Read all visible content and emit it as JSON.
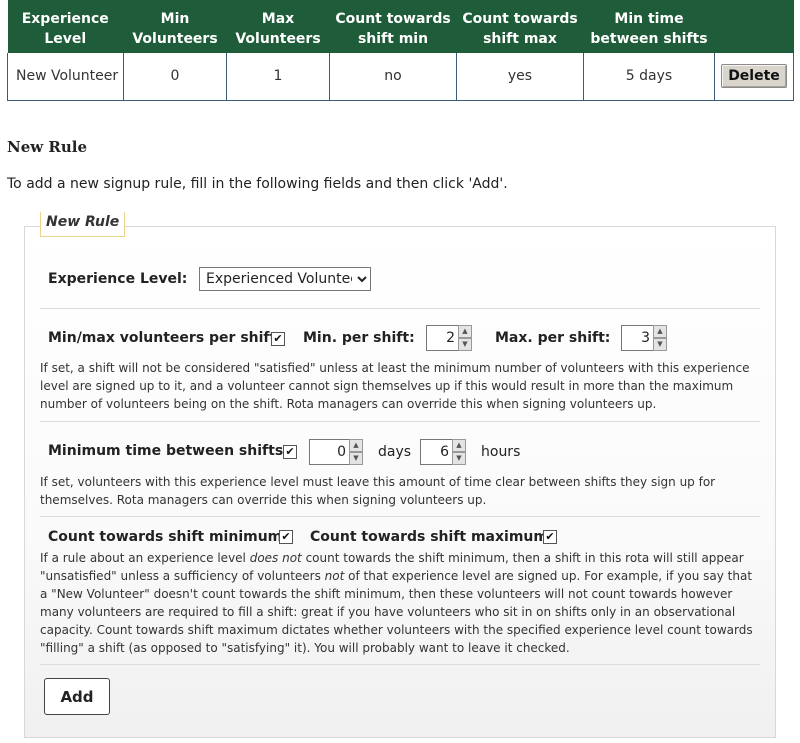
{
  "table": {
    "headers": [
      "Experience Level",
      "Min Volunteers",
      "Max Volunteers",
      "Count towards shift min",
      "Count towards shift max",
      "Min time between shifts"
    ],
    "rows": [
      {
        "level": "New Volunteer",
        "min": "0",
        "max": "1",
        "count_min": "no",
        "count_max": "yes",
        "min_time": "5 days",
        "delete_label": "Delete"
      }
    ]
  },
  "new_rule": {
    "heading": "New Rule",
    "intro": "To add a new signup rule, fill in the following fields and then click 'Add'.",
    "legend": "New Rule",
    "experience_label": "Experience Level:",
    "experience_selected": "Experienced Volunteer",
    "minmax_label": "Min/max volunteers per shift:",
    "minmax_checked": true,
    "min_per_shift_label": "Min. per shift:",
    "min_per_shift_value": "2",
    "max_per_shift_label": "Max. per shift:",
    "max_per_shift_value": "3",
    "minmax_help": "If set, a shift will not be considered \"satisfied\" unless at least the minimum number of volunteers with this experience level are signed up to it, and a volunteer cannot sign themselves up if this would result in more than the maximum number of volunteers being on the shift. Rota managers can override this when signing volunteers up.",
    "min_time_label": "Minimum time between shifts:",
    "min_time_checked": true,
    "days_value": "0",
    "days_label": "days",
    "hours_value": "6",
    "hours_label": "hours",
    "min_time_help": "If set, volunteers with this experience level must leave this amount of time clear between shifts they sign up for themselves. Rota managers can override this when signing volunteers up.",
    "count_min_label": "Count towards shift minimum:",
    "count_min_checked": true,
    "count_max_label": "Count towards shift maximum:",
    "count_max_checked": true,
    "count_help_1": "If a rule about an experience level ",
    "count_help_em1": "does not",
    "count_help_2": " count towards the shift minimum, then a shift in this rota will still appear \"unsatisfied\" unless a sufficiency of volunteers ",
    "count_help_em2": "not",
    "count_help_3": " of that experience level are signed up. For example, if you say that a \"New Volunteer\" doesn't count towards the shift minimum, then these volunteers will not count towards however many volunteers are required to fill a shift: great if you have volunteers who sit in on shifts only in an observational capacity. Count towards shift maximum dictates whether volunteers with the specified experience level count towards \"filling\" a shift (as opposed to \"satisfying\" it). You will probably want to leave it checked.",
    "add_label": "Add"
  }
}
